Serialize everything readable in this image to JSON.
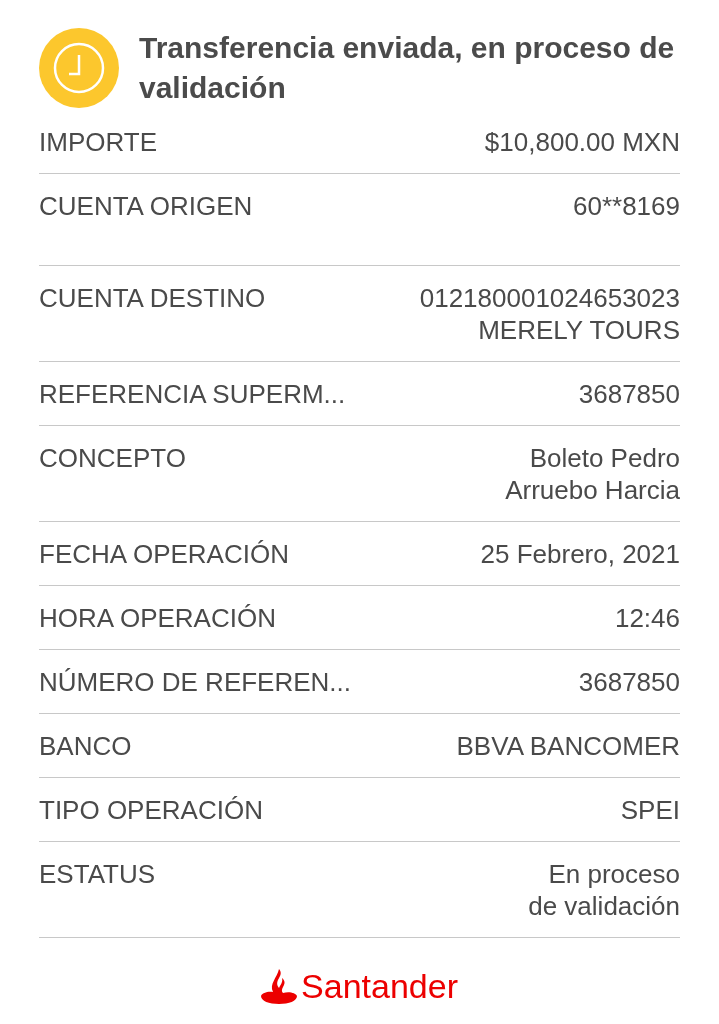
{
  "header": {
    "title": "Transferencia enviada, en proceso de validación"
  },
  "rows": [
    {
      "label": "IMPORTE",
      "value": [
        "$10,800.00 MXN"
      ]
    },
    {
      "label": "CUENTA ORIGEN",
      "value": [
        "60**8169"
      ]
    },
    {
      "label": "CUENTA DESTINO",
      "value": [
        "012180001024653023",
        "MERELY TOURS"
      ]
    },
    {
      "label": "REFERENCIA SUPERM...",
      "value": [
        "3687850"
      ]
    },
    {
      "label": "CONCEPTO",
      "value": [
        "Boleto Pedro",
        "Arruebo Harcia"
      ]
    },
    {
      "label": "FECHA OPERACIÓN",
      "value": [
        "25 Febrero, 2021"
      ]
    },
    {
      "label": "HORA OPERACIÓN",
      "value": [
        "12:46"
      ]
    },
    {
      "label": "NÚMERO DE REFEREN...",
      "value": [
        "3687850"
      ]
    },
    {
      "label": "BANCO",
      "value": [
        "BBVA BANCOMER"
      ]
    },
    {
      "label": "TIPO OPERACIÓN",
      "value": [
        "SPEI"
      ]
    },
    {
      "label": "ESTATUS",
      "value": [
        "En proceso",
        "de validación"
      ]
    }
  ],
  "footer": {
    "brand": "Santander"
  }
}
